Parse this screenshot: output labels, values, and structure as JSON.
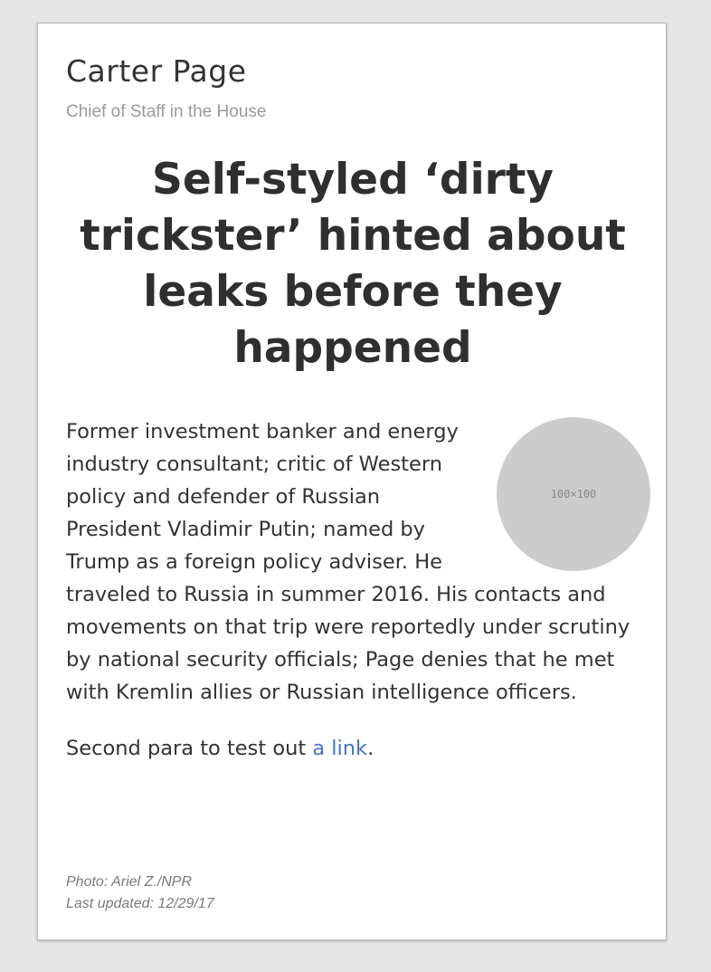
{
  "profile": {
    "name": "Carter Page",
    "role": "Chief of Staff in the House"
  },
  "headline": "Self-styled ‘dirty trickster’ hinted about leaks before they happened",
  "photo": {
    "placeholder_text": "100×100"
  },
  "body": {
    "paragraph_1": "Former investment banker and energy industry consultant; critic of Western policy and defender of Russian President Vladimir Putin; named by Trump as a foreign policy adviser. He traveled to Russia in summer 2016. His contacts and movements on that trip were reportedly under scrutiny by national security officials; Page denies that he met with Kremlin allies or Russian intelligence officers.",
    "paragraph_2_prefix": "Second para to test out ",
    "paragraph_2_link": "a link",
    "paragraph_2_suffix": "."
  },
  "footer": {
    "photo_credit": "Photo: Ariel Z./NPR",
    "last_updated": "Last updated: 12/29/17"
  },
  "colors": {
    "link": "#4773c1",
    "placeholder_circle": "#cccccc",
    "text": "#333333"
  }
}
